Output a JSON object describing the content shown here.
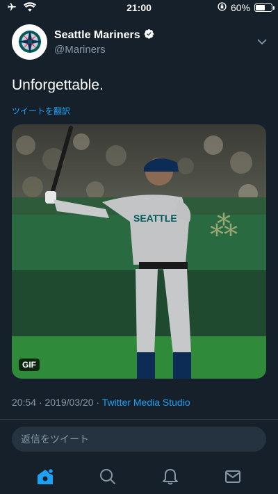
{
  "status_bar": {
    "time": "21:00",
    "battery_percent": "60%",
    "battery_level": 0.6,
    "airplane_icon": "airplane-icon",
    "wifi_icon": "wifi-icon",
    "orientation_lock_icon": "orientation-lock-icon"
  },
  "tweet": {
    "display_name": "Seattle Mariners",
    "handle": "@Mariners",
    "verified": true,
    "text": "Unforgettable.",
    "translate_label": "ツイートを翻訳",
    "media": {
      "badge": "GIF",
      "jersey_text": "SEATTLE"
    },
    "time": "20:54",
    "date": "2019/03/20",
    "separator": "·",
    "via": "Twitter Media Studio"
  },
  "reply": {
    "placeholder": "返信をツイート"
  },
  "tab_bar": {
    "items": [
      "home-icon",
      "search-icon",
      "notifications-icon",
      "messages-icon"
    ]
  },
  "colors": {
    "background": "#15202b",
    "accent": "#1da1f2",
    "secondary_text": "#8899a6",
    "reply_box": "#253341"
  }
}
